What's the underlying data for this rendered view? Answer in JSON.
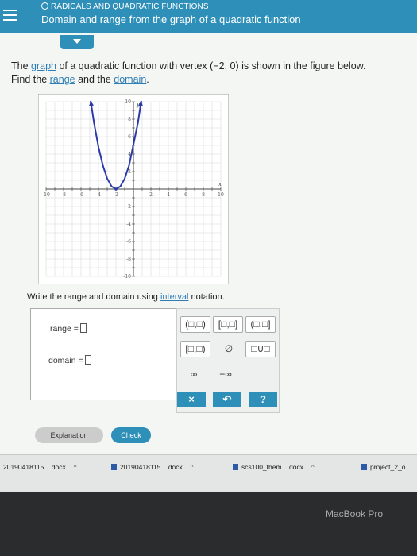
{
  "header": {
    "topic": "RADICALS AND QUADRATIC FUNCTIONS",
    "title": "Domain and range from the graph of a quadratic function"
  },
  "question": {
    "text_before": "The ",
    "link_graph": "graph",
    "text_mid": " of a quadratic function with vertex ",
    "vertex": "(−2, 0)",
    "text_after": " is shown in the figure below.",
    "line2_before": "Find the ",
    "link_range": "range",
    "line2_mid": " and the ",
    "link_domain": "domain",
    "line2_after": "."
  },
  "chart_data": {
    "type": "line",
    "xlim": [
      -10,
      10
    ],
    "ylim": [
      -10,
      10
    ],
    "grid": true,
    "x_tick_labels": [
      "-10",
      "-8",
      "-6",
      "-4",
      "-2",
      "2",
      "4",
      "6",
      "8",
      "10"
    ],
    "y_tick_labels": [
      "10",
      "8",
      "6",
      "4",
      "2",
      "-2",
      "-4",
      "-6",
      "-8",
      "-10"
    ],
    "x_axis_label": "x",
    "y_axis_label": "y",
    "series": [
      {
        "color": "#2b3aa8",
        "x": [
          -4.9,
          -4.5,
          -4,
          -3.5,
          -3,
          -2.5,
          -2,
          -1.5,
          -1,
          -0.5,
          0.5,
          0.9
        ],
        "y": [
          10.1,
          7.5,
          4.8,
          2.7,
          1.2,
          0.3,
          0,
          0.3,
          1.2,
          2.7,
          7.5,
          10.1
        ]
      }
    ],
    "vertex": [
      -2,
      0
    ]
  },
  "instruction": {
    "before": "Write the range and domain using ",
    "link": "interval",
    "after": " notation."
  },
  "answer": {
    "range_label": "range =",
    "domain_label": "domain ="
  },
  "palette": {
    "open_interval": "(□,□)",
    "closed_interval": "[□,□]",
    "half_open_right": "(□,□]",
    "half_open_left": "[□,□)",
    "empty_set": "∅",
    "union": "□∪□",
    "infinity": "∞",
    "neg_infinity": "−∞",
    "clear": "×",
    "undo": "↶",
    "help": "?"
  },
  "buttons": {
    "explanation": "Explanation",
    "check": "Check"
  },
  "downloads": [
    {
      "name": "20190418115....docx"
    },
    {
      "name": "20190418115....docx"
    },
    {
      "name": "scs100_them....docx"
    },
    {
      "name": "project_2_o"
    }
  ],
  "device": {
    "brand": "MacBook Pro"
  },
  "colors": {
    "accent": "#2e8fb8",
    "curve": "#2b3aa8",
    "link": "#2e7db5"
  }
}
